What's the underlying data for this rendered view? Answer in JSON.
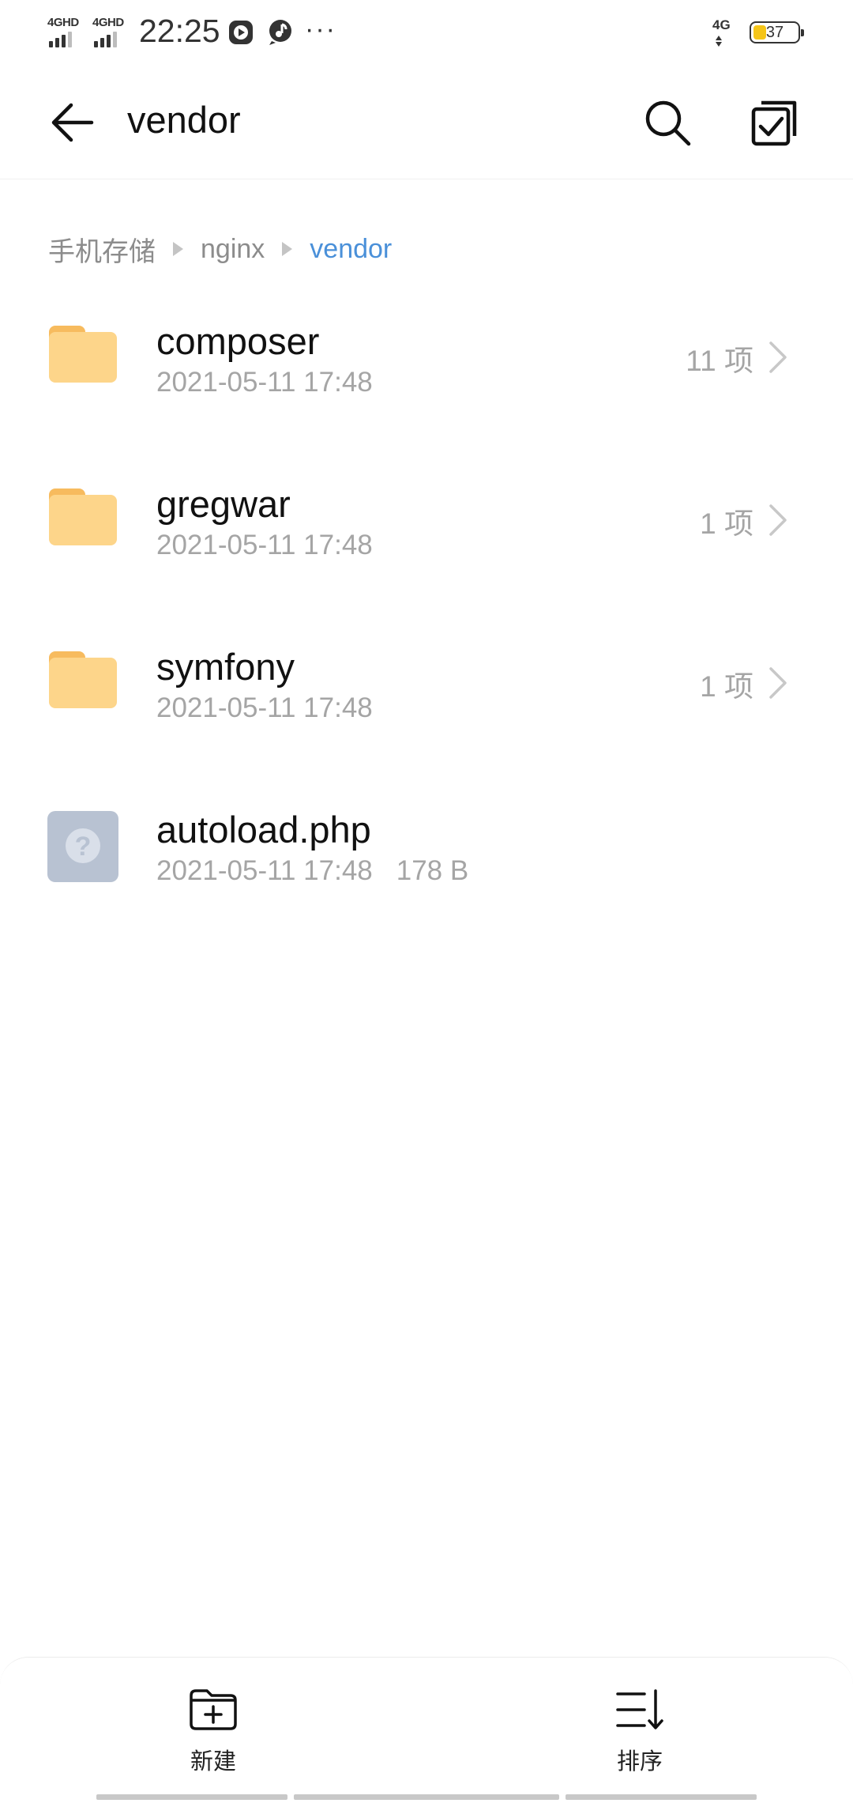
{
  "status_bar": {
    "sim1_label": "4GHD",
    "sim2_label": "4GHD",
    "time": "22:25",
    "more_indicator": "···",
    "network_label": "4G",
    "battery_percent": "37"
  },
  "header": {
    "back_icon": "arrow-left-icon",
    "title": "vendor",
    "search_icon": "search-icon",
    "select_icon": "multi-select-checkbox-icon"
  },
  "breadcrumb": {
    "items": [
      "手机存储",
      "nginx",
      "vendor"
    ]
  },
  "files": [
    {
      "name": "composer",
      "date": "2021-05-11 17:48",
      "count": "11 项",
      "type": "folder"
    },
    {
      "name": "gregwar",
      "date": "2021-05-11 17:48",
      "count": "1 项",
      "type": "folder"
    },
    {
      "name": "symfony",
      "date": "2021-05-11 17:48",
      "count": "1 项",
      "type": "folder"
    },
    {
      "name": "autoload.php",
      "date": "2021-05-11 17:48",
      "size": "178 B",
      "type": "unknown-file"
    }
  ],
  "bottom_bar": {
    "new_label": "新建",
    "sort_label": "排序"
  },
  "colors": {
    "accent": "#4a90d9",
    "folder": "#fdd58a",
    "folder_tab": "#f7bb5e",
    "muted_text": "#a5a5a5",
    "unknown_file": "#b8c2d2"
  }
}
